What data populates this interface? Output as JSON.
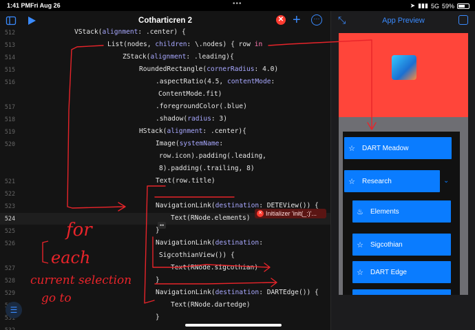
{
  "status_bar": {
    "time": "1:41 PM",
    "date": "Fri Aug 26",
    "network": "5G",
    "battery": "59%"
  },
  "editor": {
    "title": "Cotharticren 2",
    "icons": [
      "sidebar-icon",
      "run-icon",
      "error-icon",
      "plus-icon",
      "more-icon"
    ],
    "lines": [
      {
        "num": "512",
        "text": "VStack(alignment: .center) {"
      },
      {
        "num": "513",
        "text": "List(nodes, children: \\.nodes) { row in"
      },
      {
        "num": "514",
        "text": "ZStack(alignment: .leading){"
      },
      {
        "num": "515",
        "text": "RoundedRectangle(cornerRadius: 4.0)"
      },
      {
        "num": "516",
        "text": ".aspectRatio(4.5, contentMode:"
      },
      {
        "num": "",
        "text": "ContentMode.fit)"
      },
      {
        "num": "517",
        "text": ".foregroundColor(.blue)"
      },
      {
        "num": "518",
        "text": ".shadow(radius: 3)"
      },
      {
        "num": "519",
        "text": "HStack(alignment: .center){"
      },
      {
        "num": "520",
        "text": "Image(systemName:"
      },
      {
        "num": "",
        "text": "row.icon).padding(.leading,"
      },
      {
        "num": "",
        "text": "8).padding(.trailing, 8)"
      },
      {
        "num": "521",
        "text": "Text(row.title)"
      },
      {
        "num": "522",
        "text": ""
      },
      {
        "num": "523",
        "text": "NavigationLink(destination: DETEView()) {"
      },
      {
        "num": "524",
        "text": "Text(RNode.elements)"
      },
      {
        "num": "525",
        "text": "}"
      },
      {
        "num": "526",
        "text": "NavigationLink(destination:"
      },
      {
        "num": "",
        "text": "SigcothianView()) {"
      },
      {
        "num": "527",
        "text": "Text(RNode.sigcothian)"
      },
      {
        "num": "528",
        "text": "}"
      },
      {
        "num": "529",
        "text": "NavigationLink(destination: DARTEdge()) {"
      },
      {
        "num": "530",
        "text": "Text(RNode.dartedge)"
      },
      {
        "num": "531",
        "text": "}"
      },
      {
        "num": "532",
        "text": ""
      }
    ],
    "error_message": "Initializer 'init(_:)'...",
    "fold_marker": "••",
    "handwriting": [
      "for",
      "each",
      "current selection",
      "go to"
    ]
  },
  "preview": {
    "title": "App Preview",
    "rows": [
      {
        "label": "DART Meadow",
        "icon": "star-icon"
      },
      {
        "label": "Research",
        "icon": "star-icon",
        "expanded": true
      },
      {
        "label": "Elements",
        "icon": "flame-icon"
      },
      {
        "label": "Sigcothian",
        "icon": "star-icon"
      },
      {
        "label": "DART Edge",
        "icon": "star-icon"
      }
    ]
  },
  "colors": {
    "accent": "#3a8bff",
    "row_blue": "#0a7cff",
    "preview_red": "#ff453a",
    "annotation_red": "#e8242a"
  }
}
